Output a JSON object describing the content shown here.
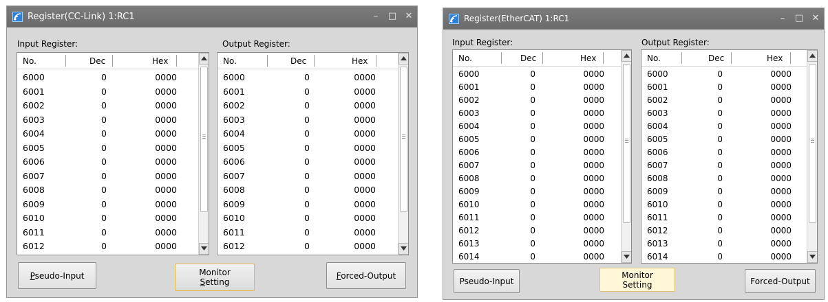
{
  "window1": {
    "title": "Register(CC-Link) 1:RC1",
    "controls": {
      "minimize": "–",
      "maximize": "□",
      "close": "✕"
    },
    "input_label": "Input Register:",
    "output_label": "Output Register:",
    "columns": [
      "No.",
      "Dec",
      "Hex"
    ],
    "input_rows": [
      {
        "no": "6000",
        "dec": "0",
        "hex": "0000"
      },
      {
        "no": "6001",
        "dec": "0",
        "hex": "0000"
      },
      {
        "no": "6002",
        "dec": "0",
        "hex": "0000"
      },
      {
        "no": "6003",
        "dec": "0",
        "hex": "0000"
      },
      {
        "no": "6004",
        "dec": "0",
        "hex": "0000"
      },
      {
        "no": "6005",
        "dec": "0",
        "hex": "0000"
      },
      {
        "no": "6006",
        "dec": "0",
        "hex": "0000"
      },
      {
        "no": "6007",
        "dec": "0",
        "hex": "0000"
      },
      {
        "no": "6008",
        "dec": "0",
        "hex": "0000"
      },
      {
        "no": "6009",
        "dec": "0",
        "hex": "0000"
      },
      {
        "no": "6010",
        "dec": "0",
        "hex": "0000"
      },
      {
        "no": "6011",
        "dec": "0",
        "hex": "0000"
      },
      {
        "no": "6012",
        "dec": "0",
        "hex": "0000"
      }
    ],
    "output_rows": [
      {
        "no": "6000",
        "dec": "0",
        "hex": "0000"
      },
      {
        "no": "6001",
        "dec": "0",
        "hex": "0000"
      },
      {
        "no": "6002",
        "dec": "0",
        "hex": "0000"
      },
      {
        "no": "6003",
        "dec": "0",
        "hex": "0000"
      },
      {
        "no": "6004",
        "dec": "0",
        "hex": "0000"
      },
      {
        "no": "6005",
        "dec": "0",
        "hex": "0000"
      },
      {
        "no": "6006",
        "dec": "0",
        "hex": "0000"
      },
      {
        "no": "6007",
        "dec": "0",
        "hex": "0000"
      },
      {
        "no": "6008",
        "dec": "0",
        "hex": "0000"
      },
      {
        "no": "6009",
        "dec": "0",
        "hex": "0000"
      },
      {
        "no": "6010",
        "dec": "0",
        "hex": "0000"
      },
      {
        "no": "6011",
        "dec": "0",
        "hex": "0000"
      },
      {
        "no": "6012",
        "dec": "0",
        "hex": "0000"
      }
    ],
    "buttons": {
      "pseudo_input_mnemonic": "P",
      "pseudo_input_rest": "seudo-Input",
      "monitor_line1": "Monitor",
      "monitor_line2_mnemonic": "S",
      "monitor_line2_rest": "etting",
      "forced_output_mnemonic": "F",
      "forced_output_rest": "orced-Output"
    }
  },
  "window2": {
    "title": "Register(EtherCAT) 1:RC1",
    "controls": {
      "minimize": "–",
      "maximize": "□",
      "close": "✕"
    },
    "input_label": "Input Register:",
    "output_label": "Output Register:",
    "columns": [
      "No.",
      "Dec",
      "Hex"
    ],
    "input_rows": [
      {
        "no": "6000",
        "dec": "0",
        "hex": "0000"
      },
      {
        "no": "6001",
        "dec": "0",
        "hex": "0000"
      },
      {
        "no": "6002",
        "dec": "0",
        "hex": "0000"
      },
      {
        "no": "6003",
        "dec": "0",
        "hex": "0000"
      },
      {
        "no": "6004",
        "dec": "0",
        "hex": "0000"
      },
      {
        "no": "6005",
        "dec": "0",
        "hex": "0000"
      },
      {
        "no": "6006",
        "dec": "0",
        "hex": "0000"
      },
      {
        "no": "6007",
        "dec": "0",
        "hex": "0000"
      },
      {
        "no": "6008",
        "dec": "0",
        "hex": "0000"
      },
      {
        "no": "6009",
        "dec": "0",
        "hex": "0000"
      },
      {
        "no": "6010",
        "dec": "0",
        "hex": "0000"
      },
      {
        "no": "6011",
        "dec": "0",
        "hex": "0000"
      },
      {
        "no": "6012",
        "dec": "0",
        "hex": "0000"
      },
      {
        "no": "6013",
        "dec": "0",
        "hex": "0000"
      },
      {
        "no": "6014",
        "dec": "0",
        "hex": "0000"
      }
    ],
    "output_rows": [
      {
        "no": "6000",
        "dec": "0",
        "hex": "0000"
      },
      {
        "no": "6001",
        "dec": "0",
        "hex": "0000"
      },
      {
        "no": "6002",
        "dec": "0",
        "hex": "0000"
      },
      {
        "no": "6003",
        "dec": "0",
        "hex": "0000"
      },
      {
        "no": "6004",
        "dec": "0",
        "hex": "0000"
      },
      {
        "no": "6005",
        "dec": "0",
        "hex": "0000"
      },
      {
        "no": "6006",
        "dec": "0",
        "hex": "0000"
      },
      {
        "no": "6007",
        "dec": "0",
        "hex": "0000"
      },
      {
        "no": "6008",
        "dec": "0",
        "hex": "0000"
      },
      {
        "no": "6009",
        "dec": "0",
        "hex": "0000"
      },
      {
        "no": "6010",
        "dec": "0",
        "hex": "0000"
      },
      {
        "no": "6011",
        "dec": "0",
        "hex": "0000"
      },
      {
        "no": "6012",
        "dec": "0",
        "hex": "0000"
      },
      {
        "no": "6013",
        "dec": "0",
        "hex": "0000"
      },
      {
        "no": "6014",
        "dec": "0",
        "hex": "0000"
      }
    ],
    "buttons": {
      "pseudo_input": "Pseudo-Input",
      "monitor_line1": "Monitor",
      "monitor_line2": "Setting",
      "forced_output": "Forced-Output"
    }
  },
  "icons": {
    "app": "app-signal-icon",
    "scroll_up": "scroll-up-arrow-icon",
    "scroll_down": "scroll-down-arrow-icon"
  }
}
